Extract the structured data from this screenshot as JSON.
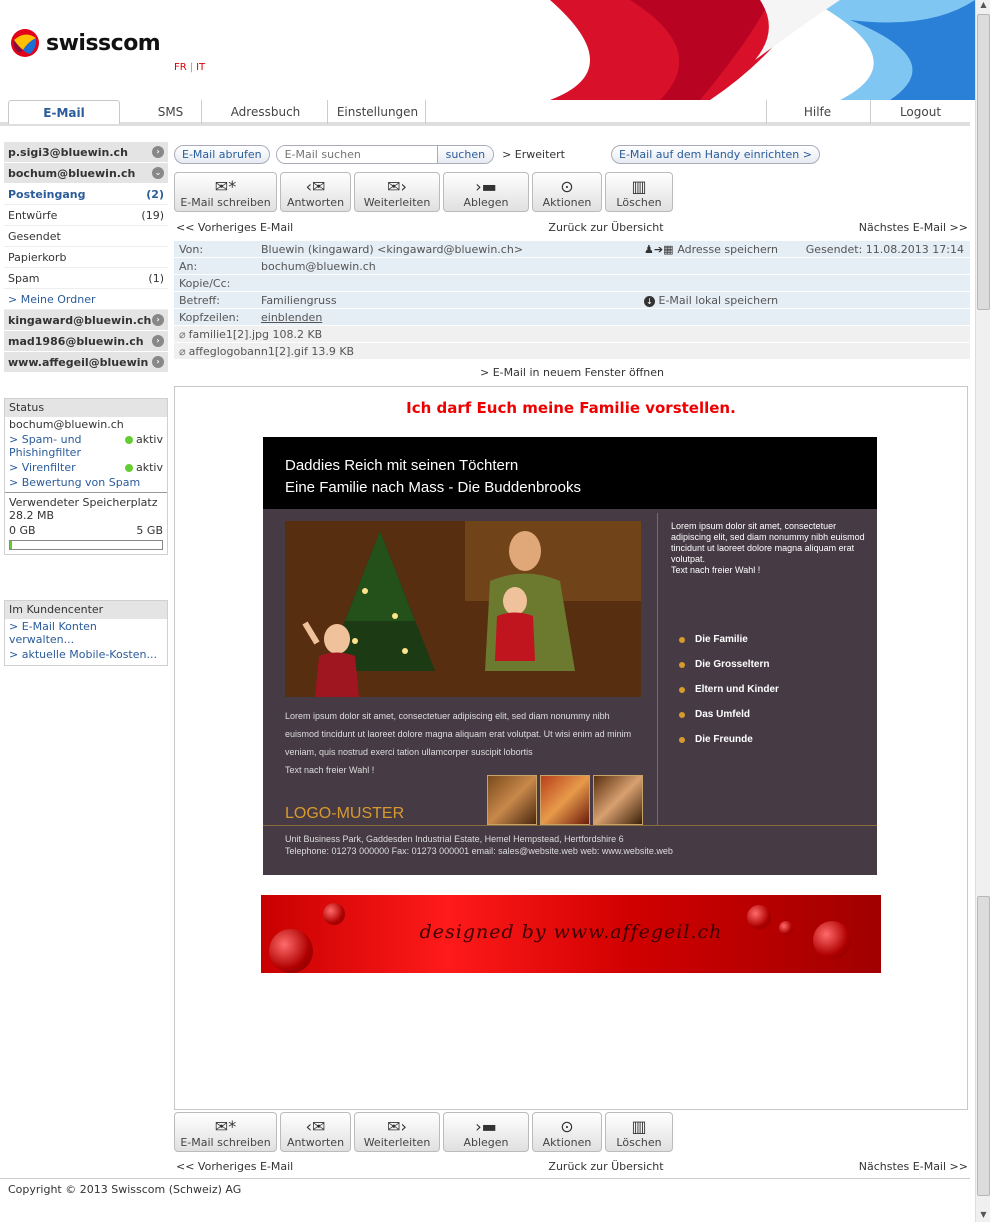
{
  "brand": {
    "name": "swisscom",
    "lang_fr": "FR",
    "lang_it": "IT",
    "colors": {
      "accent": "#2a5b9a",
      "red": "#e00000"
    }
  },
  "tabs": {
    "email": "E-Mail",
    "sms": "SMS",
    "addressbook": "Adressbuch",
    "settings": "Einstellungen",
    "help": "Hilfe",
    "logout": "Logout"
  },
  "sidebar": {
    "accounts_top": [
      "p.sigi3@bluewin.ch",
      "bochum@bluewin.ch"
    ],
    "folders": [
      {
        "label": "Posteingang",
        "count": "(2)"
      },
      {
        "label": "Entwürfe",
        "count": "(19)"
      },
      {
        "label": "Gesendet",
        "count": ""
      },
      {
        "label": "Papierkorb",
        "count": ""
      },
      {
        "label": "Spam",
        "count": "(1)"
      }
    ],
    "my_folders": "> Meine Ordner",
    "accounts_bottom": [
      "kingaward@bluewin.ch",
      "mad1986@bluewin.ch",
      "www.affegeil@bluewin.ch"
    ]
  },
  "status": {
    "title": "Status",
    "account": "bochum@bluewin.ch",
    "spam_filter": "> Spam- und Phishingfilter",
    "spam_state": "aktiv",
    "virus_filter": "> Virenfilter",
    "virus_state": "aktiv",
    "spam_rating": "> Bewertung von Spam",
    "storage_label": "Verwendeter Speicherplatz",
    "storage_used": "28.2 MB",
    "quota_min": "0 GB",
    "quota_max": "5 GB",
    "quota_fraction": 0.006
  },
  "customer": {
    "title": "Im Kundencenter",
    "link1": "> E-Mail Konten verwalten...",
    "link2": "> aktuelle Mobile-Kosten..."
  },
  "topbar": {
    "fetch": "E-Mail abrufen",
    "search_placeholder": "E-Mail suchen",
    "search_btn": "suchen",
    "advanced": "> Erweitert",
    "mobile": "E-Mail auf dem Handy einrichten >"
  },
  "toolbar": {
    "compose": "E-Mail schreiben",
    "reply": "Antworten",
    "forward": "Weiterleiten",
    "file": "Ablegen",
    "actions": "Aktionen",
    "delete": "Löschen"
  },
  "nav": {
    "prev": "<< Vorheriges E-Mail",
    "overview": "Zurück zur Übersicht",
    "next": "Nächstes E-Mail >>"
  },
  "header": {
    "from_label": "Von:",
    "from_value": "Bluewin (kingaward) <kingaward@bluewin.ch>",
    "save_address": "Adresse speichern",
    "sent": "Gesendet: 11.08.2013 17:14",
    "to_label": "An:",
    "to_value": "bochum@bluewin.ch",
    "cc_label": "Kopie/Cc:",
    "subject_label": "Betreff:",
    "subject_value": "Familiengruss",
    "save_local": "E-Mail lokal speichern",
    "headers_label": "Kopfzeilen:",
    "headers_value": "einblenden"
  },
  "attachments": [
    "familie1[2].jpg 108.2 KB",
    "affeglogobann1[2].gif 13.9 KB"
  ],
  "open_window": "> E-Mail in neuem Fenster öffnen",
  "mail": {
    "title": "Ich darf Euch meine Familie vorstellen.",
    "nl_line1": "Daddies Reich mit seinen Töchtern",
    "nl_line2": "Eine Familie nach Mass - Die Buddenbrooks",
    "nl_side": "Lorem ipsum dolor sit amet, consectetuer adipiscing elit, sed diam nonummy nibh euismod tincidunt ut laoreet dolore magna aliquam erat volutpat.",
    "nl_side2": "Text nach freier Wahl !",
    "nl_list": [
      "Die Familie",
      "Die Grosseltern",
      "Eltern und Kinder",
      "Das Umfeld",
      "Die Freunde"
    ],
    "nl_lorem": "Lorem ipsum dolor sit amet, consectetuer adipiscing elit, sed diam nonummy nibh euismod tincidunt ut laoreet dolore magna aliquam erat volutpat. Ut wisi enim ad minim veniam, quis nostrud exerci tation ullamcorper suscipit lobortis",
    "nl_lorem2": "Text nach freier Wahl !",
    "nl_logo": "LOGO-MUSTER",
    "nl_foot1": "Unit Business Park, Gaddesden Industrial Estate, Hemel Hempstead, Hertfordshire 6",
    "nl_foot2": "Telephone: 01273 000000 Fax: 01273 000001 email: sales@website.web web: www.website.web",
    "banner": "designed by www.affegeil.ch"
  },
  "footer": "Copyright © 2013 Swisscom (Schweiz) AG"
}
